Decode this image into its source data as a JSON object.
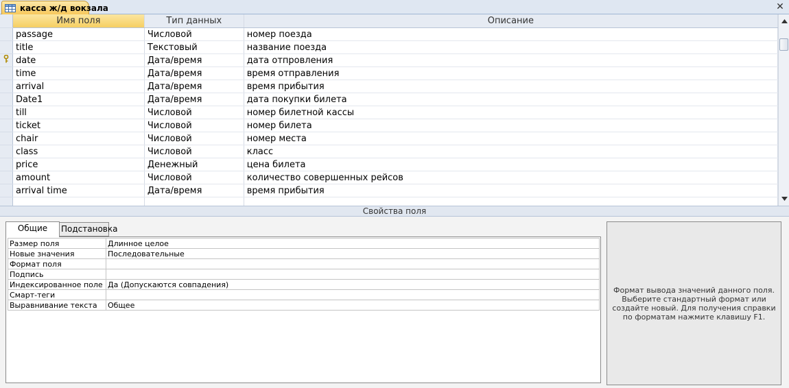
{
  "document_tab": {
    "label": "касса ж/д вокзала",
    "icon": "table-icon"
  },
  "close_label": "✕",
  "grid": {
    "columns": [
      "Имя поля",
      "Тип данных",
      "Описание"
    ],
    "rows": [
      {
        "name": "passage",
        "type": "Числовой",
        "description": "номер поезда",
        "key": false
      },
      {
        "name": "title",
        "type": "Текстовый",
        "description": "название поезда",
        "key": false
      },
      {
        "name": "date",
        "type": "Дата/время",
        "description": "дата отпровления",
        "key": true
      },
      {
        "name": "time",
        "type": "Дата/время",
        "description": "время отправления",
        "key": false
      },
      {
        "name": "arrival",
        "type": "Дата/время",
        "description": "время прибытия",
        "key": false
      },
      {
        "name": "Date1",
        "type": "Дата/время",
        "description": "дата покупки билета",
        "key": false
      },
      {
        "name": "till",
        "type": "Числовой",
        "description": "номер билетной кассы",
        "key": false
      },
      {
        "name": "ticket",
        "type": "Числовой",
        "description": "номер билета",
        "key": false
      },
      {
        "name": "chair",
        "type": "Числовой",
        "description": "номер места",
        "key": false
      },
      {
        "name": "class",
        "type": "Числовой",
        "description": "класс",
        "key": false
      },
      {
        "name": "price",
        "type": "Денежный",
        "description": "цена билета",
        "key": false
      },
      {
        "name": "amount",
        "type": "Числовой",
        "description": "количество совершенных рейсов",
        "key": false
      },
      {
        "name": "arrival time",
        "type": "Дата/время",
        "description": "время прибытия",
        "key": false
      },
      {
        "name": "",
        "type": "",
        "description": "",
        "key": false
      }
    ]
  },
  "properties": {
    "header": "Свойства поля",
    "tabs": [
      "Общие",
      "Подстановка"
    ],
    "rows": [
      {
        "label": "Размер поля",
        "value": "Длинное целое"
      },
      {
        "label": "Новые значения",
        "value": "Последовательные"
      },
      {
        "label": "Формат поля",
        "value": ""
      },
      {
        "label": "Подпись",
        "value": ""
      },
      {
        "label": "Индексированное поле",
        "value": "Да (Допускаются совпадения)"
      },
      {
        "label": "Смарт-теги",
        "value": ""
      },
      {
        "label": "Выравнивание текста",
        "value": "Общее"
      }
    ],
    "help_text": "Формат вывода значений данного поля. Выберите стандартный формат или создайте новый. Для получения справки по форматам нажмите клавишу F1."
  },
  "colors": {
    "active_header": "#f6cf62",
    "tab_accent": "#f7c85c",
    "panel_bg": "#f3f3f3"
  }
}
